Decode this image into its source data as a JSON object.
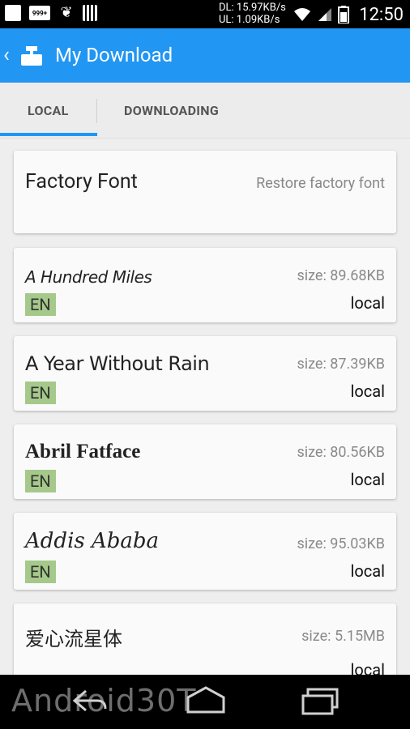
{
  "status_bar": {
    "notification_badge": "999+",
    "download_speed": "DL: 15.97KB/s",
    "upload_speed": "UL: 1.09KB/s",
    "clock": "12:50"
  },
  "app_bar": {
    "title": "My Download"
  },
  "tabs": [
    {
      "label": "LOCAL",
      "active": true
    },
    {
      "label": "DOWNLOADING",
      "active": false
    }
  ],
  "factory_card": {
    "title": "Factory Font",
    "action": "Restore factory font"
  },
  "fonts": [
    {
      "name": "A Hundred Miles",
      "size": "size: 89.68KB",
      "lang": "EN",
      "location": "local"
    },
    {
      "name": "A Year Without Rain",
      "size": "size: 87.39KB",
      "lang": "EN",
      "location": "local"
    },
    {
      "name": "Abril Fatface",
      "size": "size: 80.56KB",
      "lang": "EN",
      "location": "local"
    },
    {
      "name": "Addis Ababa",
      "size": "size: 95.03KB",
      "lang": "EN",
      "location": "local"
    },
    {
      "name": "爱心流星体",
      "size": "size: 5.15MB",
      "lang": "",
      "location": "local"
    }
  ],
  "watermark": "Android30T",
  "colors": {
    "accent": "#2196f3",
    "badge": "#a5c98a"
  }
}
